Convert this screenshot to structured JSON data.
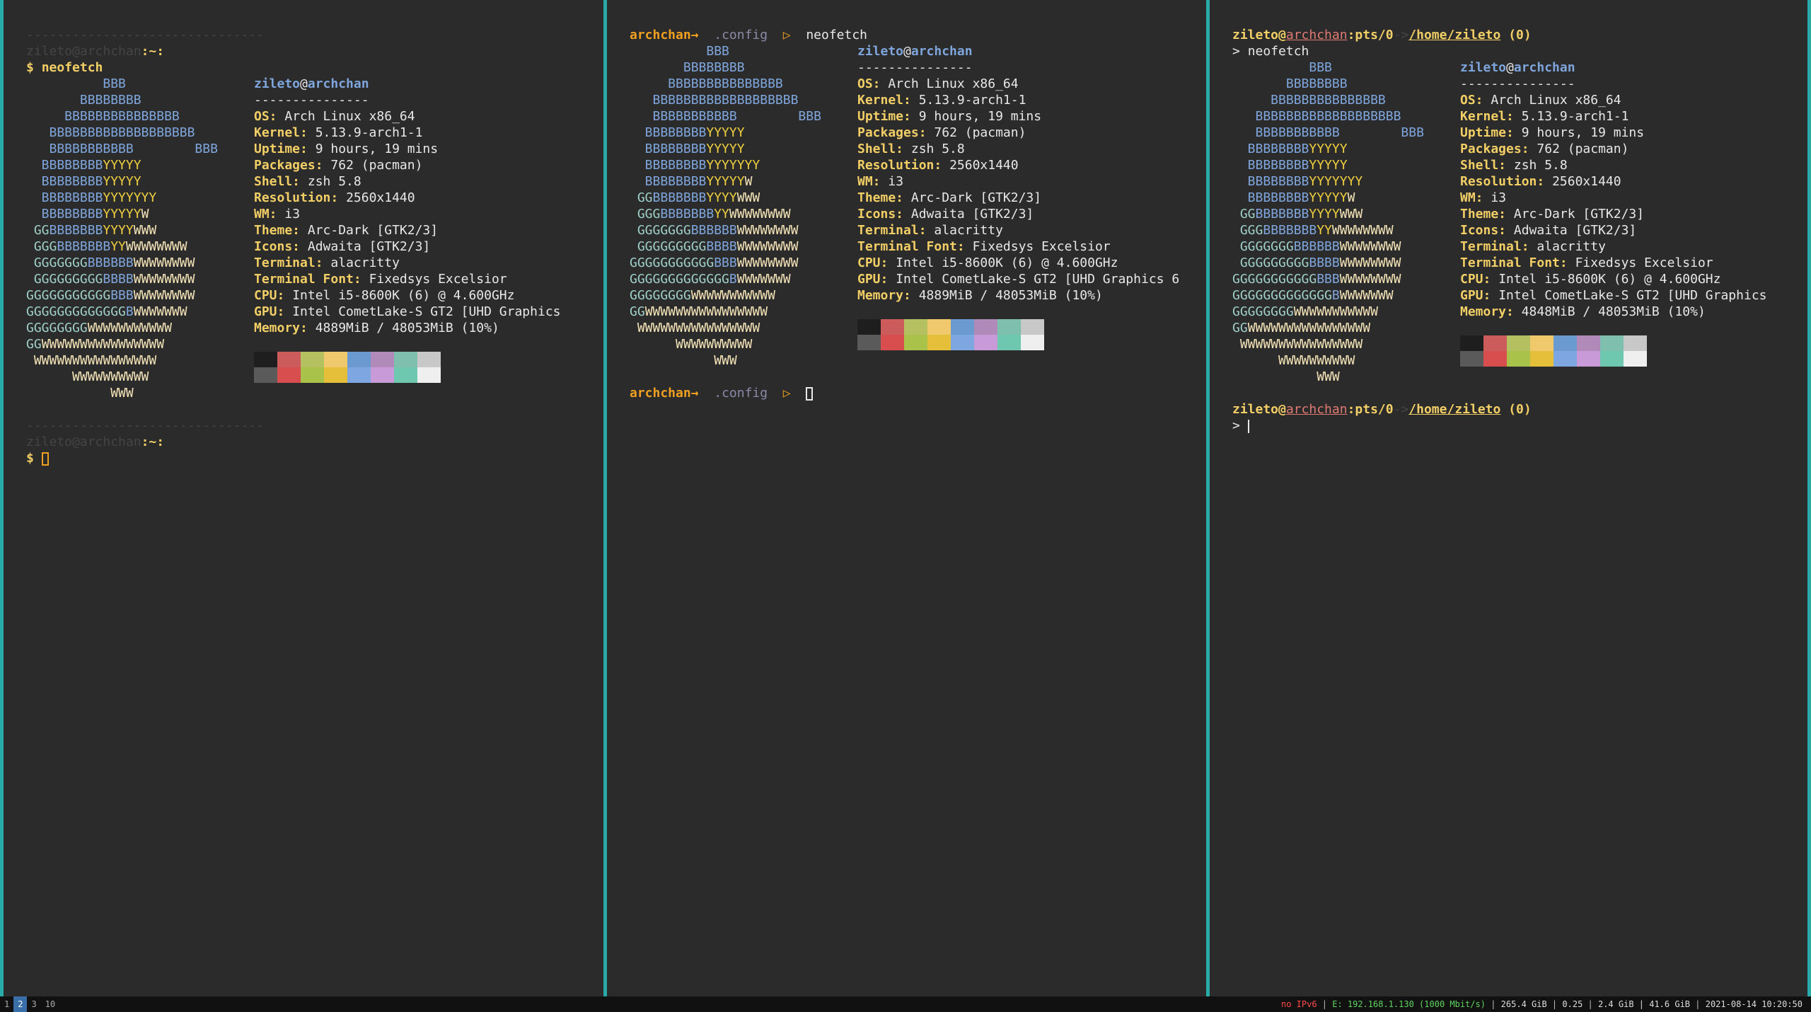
{
  "panes": [
    {
      "id": "left",
      "separator": "-------------------------------",
      "prompt_user": "zileto",
      "prompt_at": "@",
      "prompt_host": "archchan",
      "prompt_path": ":~:",
      "prompt_symbol": "$",
      "command": "neofetch",
      "separator2": "-------------------------------",
      "prompt2_user": "zileto",
      "prompt2_at": "@",
      "prompt2_host": "archchan",
      "prompt2_path": ":~:",
      "prompt2_symbol": "$"
    },
    {
      "id": "middle",
      "prompt_host": "archchan→",
      "prompt_dir": ".config",
      "prompt_arrow": "▷",
      "command": "neofetch",
      "prompt2_host": "archchan→",
      "prompt2_dir": ".config",
      "prompt2_arrow": "▷"
    },
    {
      "id": "right",
      "prompt_user": "zileto",
      "prompt_at": "@",
      "prompt_host": "archchan",
      "prompt_tty": ":pts/0",
      "prompt_arrow": "->",
      "prompt_path": "/home/zileto",
      "prompt_status": "(0)",
      "prompt_symbol": ">",
      "command": "neofetch",
      "prompt2_user": "zileto",
      "prompt2_at": "@",
      "prompt2_host": "archchan",
      "prompt2_tty": ":pts/0",
      "prompt2_arrow": "->",
      "prompt2_path": "/home/zileto",
      "prompt2_status": "(0)",
      "prompt2_symbol": ">"
    }
  ],
  "neofetch": {
    "user": "zileto",
    "at": "@",
    "host": "archchan",
    "underline": "---------------",
    "fields": [
      {
        "key": "OS",
        "value": "Arch Linux x86_64"
      },
      {
        "key": "Kernel",
        "value": "5.13.9-arch1-1"
      },
      {
        "key": "Uptime",
        "value": "9 hours, 19 mins"
      },
      {
        "key": "Packages",
        "value": "762 (pacman)"
      },
      {
        "key": "Shell",
        "value": "zsh 5.8"
      },
      {
        "key": "Resolution",
        "value": "2560x1440"
      },
      {
        "key": "WM",
        "value": "i3"
      },
      {
        "key": "Theme",
        "value": "Arc-Dark [GTK2/3]"
      },
      {
        "key": "Icons",
        "value": "Adwaita [GTK2/3]"
      },
      {
        "key": "Terminal",
        "value": "alacritty"
      },
      {
        "key": "Terminal Font",
        "value": "Fixedsys Excelsior"
      },
      {
        "key": "CPU",
        "value": "Intel i5-8600K (6) @ 4.600GHz"
      }
    ],
    "gpu_left": "Intel CometLake-S GT2 [UHD Graphics",
    "gpu_middle": "Intel CometLake-S GT2 [UHD Graphics 6",
    "gpu_right": "Intel CometLake-S GT2 [UHD Graphics",
    "memory_left": "4889MiB / 48053MiB (10%)",
    "memory_middle": "4889MiB / 48053MiB (10%)",
    "memory_right": "4848MiB / 48053MiB (10%)",
    "gpu_key": "GPU",
    "memory_key": "Memory",
    "palette_top": [
      "#1e1e1e",
      "#cc5c5c",
      "#b5c060",
      "#efc96b",
      "#6a9ad0",
      "#b08ab8",
      "#7ebfae",
      "#c8c8c8"
    ],
    "palette_bottom": [
      "#5a5a5a",
      "#d84e4e",
      "#a9c24a",
      "#e6bf3a",
      "#7ea6e0",
      "#c89ad8",
      "#6ec8b0",
      "#efefef"
    ]
  },
  "logo": [
    [
      [
        "b",
        "          BBB"
      ]
    ],
    [
      [
        "b",
        "       BBBBBBBB"
      ]
    ],
    [
      [
        "b",
        "     BBBBBBBBBBBBBBB"
      ]
    ],
    [
      [
        "b",
        "   BBBBBBBBBBBBBBBBBBB"
      ]
    ],
    [
      [
        "b",
        "   BBBBBBBBBBB        BBB"
      ]
    ],
    [
      [
        "b",
        "  BBBBBBBB"
      ],
      [
        "y",
        "YYYYY"
      ]
    ],
    [
      [
        "b",
        "  BBBBBBBB"
      ],
      [
        "y",
        "YYYYY"
      ]
    ],
    [
      [
        "b",
        "  BBBBBBBB"
      ],
      [
        "y",
        "YYYYYYY"
      ]
    ],
    [
      [
        "b",
        "  BBBBBBBB"
      ],
      [
        "y",
        "YYYYY"
      ],
      [
        "w",
        "W"
      ]
    ],
    [
      [
        "g",
        " GG"
      ],
      [
        "b",
        "BBBBBBB"
      ],
      [
        "y",
        "YYYY"
      ],
      [
        "w",
        "WWW"
      ]
    ],
    [
      [
        "g",
        " GGG"
      ],
      [
        "b",
        "BBBBBBB"
      ],
      [
        "y",
        "YY"
      ],
      [
        "w",
        "WWWWWWWW"
      ]
    ],
    [
      [
        "g",
        " GGGGGGG"
      ],
      [
        "b",
        "BBBBBB"
      ],
      [
        "w",
        "WWWWWWWW"
      ]
    ],
    [
      [
        "g",
        " GGGGGGGGG"
      ],
      [
        "b",
        "BBBB"
      ],
      [
        "w",
        "WWWWWWWW"
      ]
    ],
    [
      [
        "g",
        "GGGGGGGGGGG"
      ],
      [
        "b",
        "BBB"
      ],
      [
        "w",
        "WWWWWWWW"
      ]
    ],
    [
      [
        "g",
        "GGGGGGGGGGGGG"
      ],
      [
        "b",
        "B"
      ],
      [
        "w",
        "WWWWWWW"
      ]
    ],
    [
      [
        "g",
        "GGGGGGGG"
      ],
      [
        "w",
        "WWWWWWWWWWW"
      ]
    ],
    [
      [
        "g",
        "GG"
      ],
      [
        "w",
        "WWWWWWWWWWWWWWWW"
      ]
    ],
    [
      [
        "w",
        " WWWWWWWWWWWWWWWW"
      ]
    ],
    [
      [
        "w",
        "      WWWWWWWWWW"
      ]
    ],
    [
      [
        "w",
        "           WWW"
      ]
    ]
  ],
  "statusbar": {
    "workspaces": [
      "1",
      "2",
      "3",
      "10"
    ],
    "active_workspace": "2",
    "no_ipv6": "no IPv6",
    "ethernet": "E: 192.168.1.130 (1000 Mbit/s)",
    "disk": "265.4 GiB",
    "load": "0.25",
    "mem": "2.4 GiB | 41.6 GiB",
    "datetime": "2021-08-14 10:20:50"
  },
  "colors": {
    "pane_bg": "#2b2b2b",
    "window_border": "#2aa9a9",
    "focus_border": "#d69a16",
    "label": "#f2cf66",
    "host": "#7fa6dc"
  }
}
